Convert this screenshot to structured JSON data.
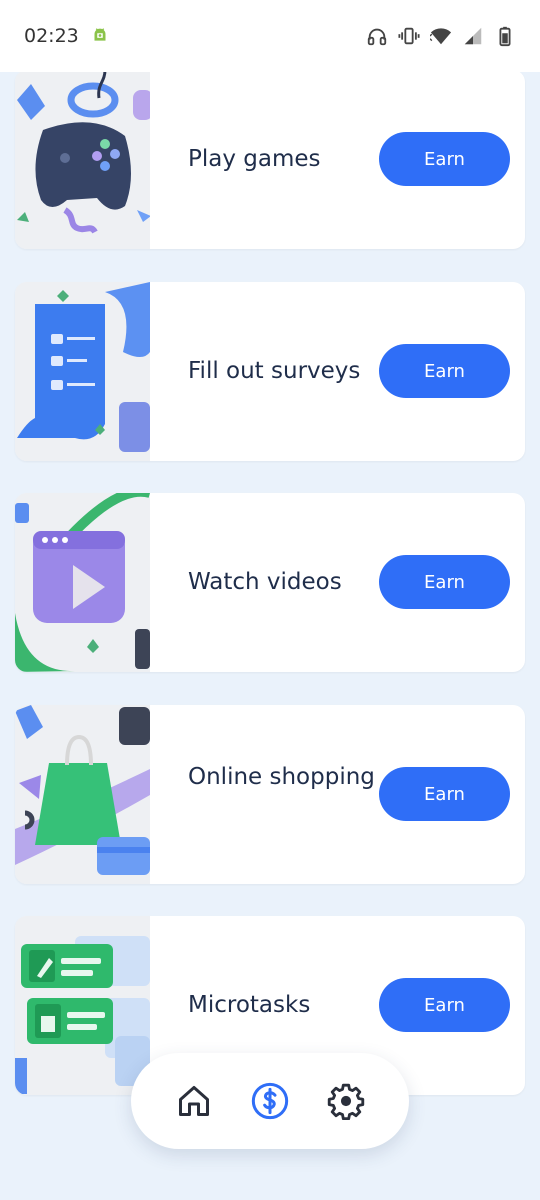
{
  "status_bar": {
    "time": "02:23",
    "icons": [
      "android-debug-icon",
      "headphones-icon",
      "vibrate-icon",
      "wifi-icon",
      "signal-icon",
      "battery-icon"
    ]
  },
  "tasks": [
    {
      "label": "Play games",
      "button": "Earn",
      "icon": "gamepad-illustration"
    },
    {
      "label": "Fill out surveys",
      "button": "Earn",
      "icon": "survey-illustration"
    },
    {
      "label": "Watch videos",
      "button": "Earn",
      "icon": "video-illustration"
    },
    {
      "label": "Online shopping",
      "button": "Earn",
      "icon": "shopping-illustration"
    },
    {
      "label": "Microtasks",
      "button": "Earn",
      "icon": "microtasks-illustration"
    }
  ],
  "bottom_nav": {
    "items": [
      "home-icon",
      "dollar-icon",
      "gear-icon"
    ],
    "active": "dollar-icon"
  },
  "colors": {
    "accent": "#2f6ef7",
    "background": "#eaf2fb",
    "text": "#1f2d4a"
  }
}
